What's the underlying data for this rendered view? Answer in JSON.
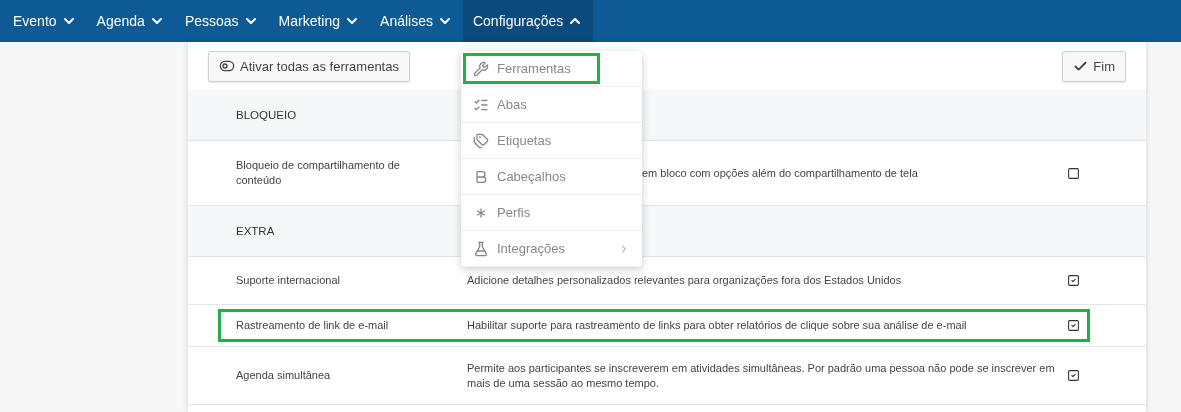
{
  "nav": [
    {
      "label": "Evento",
      "expanded": false
    },
    {
      "label": "Agenda",
      "expanded": false
    },
    {
      "label": "Pessoas",
      "expanded": false
    },
    {
      "label": "Marketing",
      "expanded": false
    },
    {
      "label": "Análises",
      "expanded": false
    },
    {
      "label": "Configurações",
      "expanded": true
    }
  ],
  "toolbar": {
    "toggle_all": "Ativar todas as ferramentas",
    "done": "Fim"
  },
  "menu": [
    {
      "kind": "wrench",
      "label": "Ferramentas",
      "highlighted": true,
      "submenu": false
    },
    {
      "kind": "checklist",
      "label": "Abas",
      "highlighted": false,
      "submenu": false
    },
    {
      "kind": "tags",
      "label": "Etiquetas",
      "highlighted": false,
      "submenu": false
    },
    {
      "kind": "bold",
      "label": "Cabeçalhos",
      "highlighted": false,
      "submenu": false
    },
    {
      "kind": "asterisk",
      "label": "Perfis",
      "highlighted": false,
      "submenu": false
    },
    {
      "kind": "flask",
      "label": "Integrações",
      "highlighted": false,
      "submenu": true
    }
  ],
  "sections": [
    {
      "title": "BLOQUEIO",
      "rows": [
        {
          "name": "Bloqueio de compartilhamento de conteúdo",
          "description": "em bloco com opções além do compartilhamento de tela",
          "kind": "covered",
          "checked": false,
          "highlighted": false
        }
      ]
    },
    {
      "title": "EXTRA",
      "rows": [
        {
          "name": "Suporte internacional",
          "description": "Adicione detalhes personalizados relevantes para organizações fora dos Estados Unidos",
          "kind": "plain",
          "checked": true,
          "highlighted": false
        },
        {
          "name": "Rastreamento de link de e-mail",
          "description": "Habilitar suporte para rastreamento de links para obter relatórios de clique sobre sua análise de e-mail",
          "kind": "plain",
          "checked": true,
          "highlighted": true
        },
        {
          "name": "Agenda simultânea",
          "description": "Permite aos participantes se inscreverem em atividades simultâneas. Por padrão uma pessoa não pode se inscrever em mais de uma sessão ao mesmo tempo.",
          "kind": "plain",
          "checked": true,
          "highlighted": false
        }
      ]
    }
  ]
}
